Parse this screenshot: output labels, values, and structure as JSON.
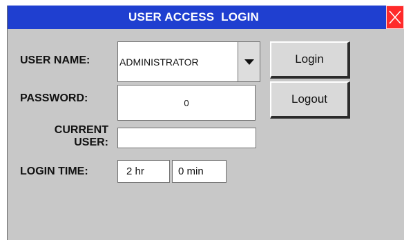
{
  "window": {
    "title": "USER ACCESS  LOGIN",
    "close_icon": "close-x-icon"
  },
  "form": {
    "username_label": "USER NAME:",
    "username_value": "ADMINISTRATOR",
    "password_label": "PASSWORD:",
    "password_value": "0",
    "current_user_label_line1": "CURRENT",
    "current_user_label_line2": "USER:",
    "current_user_value": "",
    "login_time_label": "LOGIN TIME:",
    "login_hours": "2 hr",
    "login_minutes": "0 min"
  },
  "buttons": {
    "login_label": "Login",
    "logout_label": "Logout"
  },
  "colors": {
    "titlebar": "#1f3fd0",
    "close_button": "#ff2a2a",
    "panel": "#c8c8c8"
  }
}
